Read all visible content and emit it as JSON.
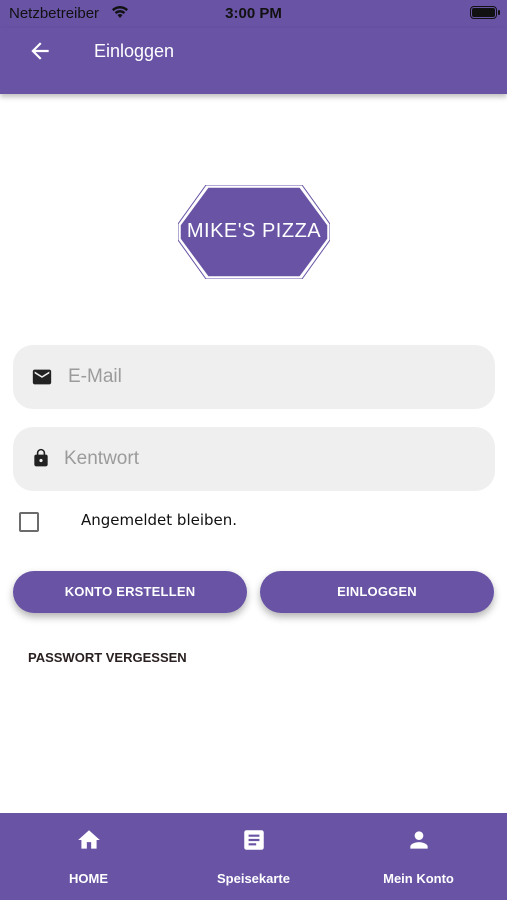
{
  "status_bar": {
    "carrier": "Netzbetreiber",
    "time": "3:00 PM"
  },
  "app_bar": {
    "title": "Einloggen",
    "back_icon": "arrow-back-icon"
  },
  "logo": {
    "text": "MIKE'S PIZZA"
  },
  "form": {
    "email_placeholder": "E-Mail",
    "password_placeholder": "Kentwort",
    "remember_label": "Angemeldet bleiben.",
    "remember_checked": false
  },
  "buttons": {
    "create_account": "KONTO ERSTELLEN",
    "login": "EINLOGGEN",
    "forgot_password": "PASSWORT VERGESSEN"
  },
  "bottom_nav": {
    "items": [
      {
        "label": "HOME",
        "icon": "home-icon"
      },
      {
        "label": "Speisekarte",
        "icon": "menu-card-icon"
      },
      {
        "label": "Mein Konto",
        "icon": "person-icon"
      }
    ]
  },
  "colors": {
    "primary": "#6853a5",
    "field_bg": "#efefef",
    "text_dark": "#2a2020"
  }
}
